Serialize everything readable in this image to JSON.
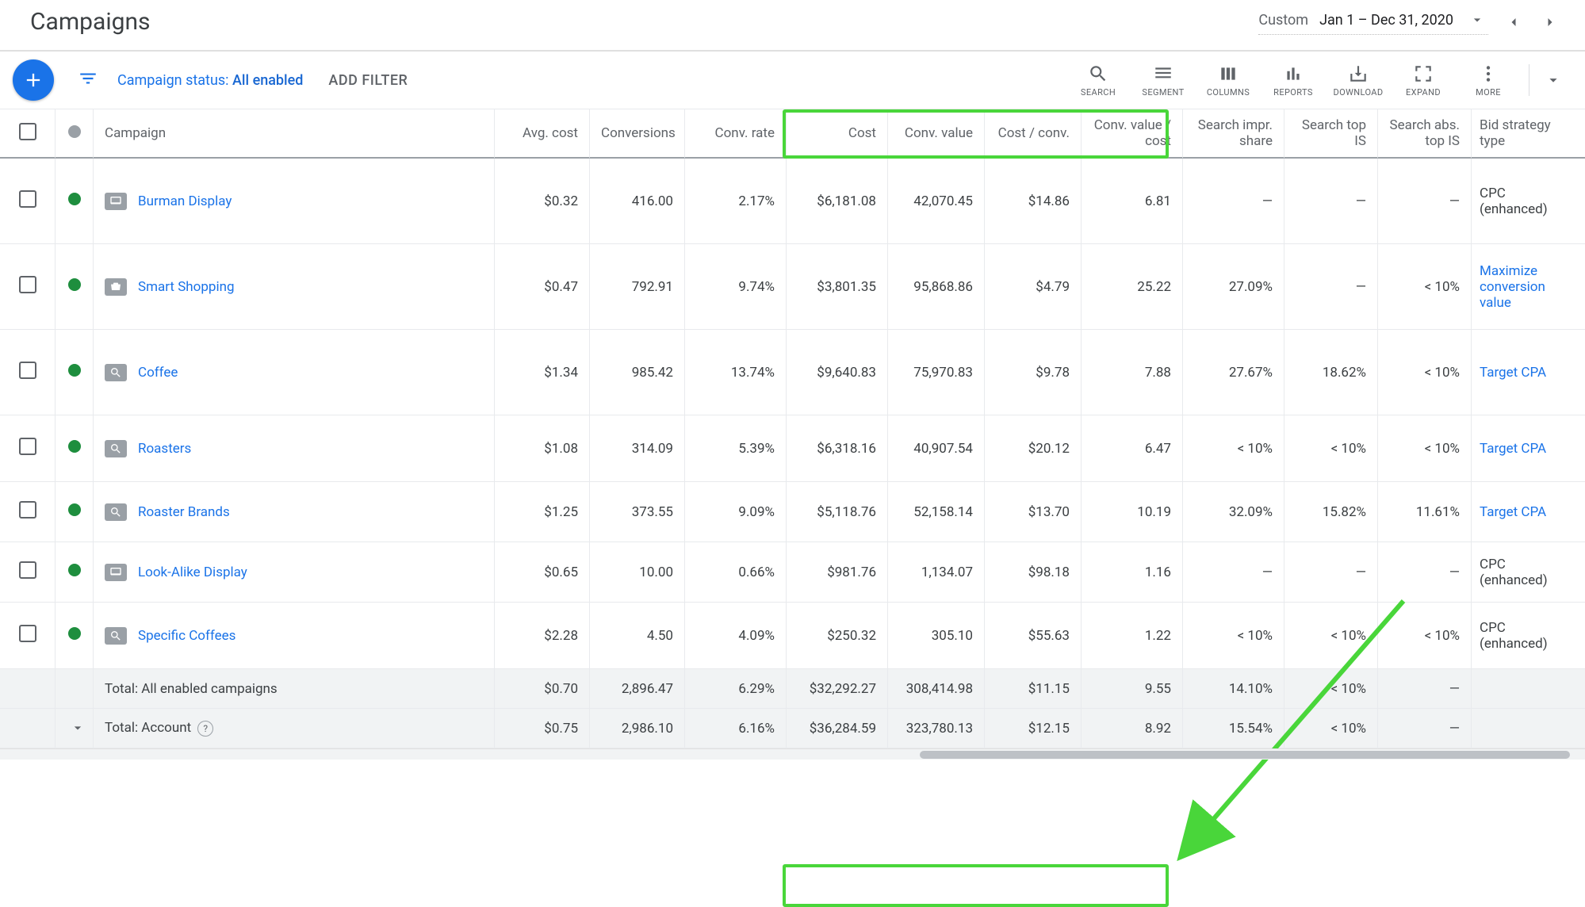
{
  "title": "Campaigns",
  "date": {
    "label": "Custom",
    "range": "Jan 1 – Dec 31, 2020"
  },
  "filter": {
    "status_prefix": "Campaign status: ",
    "status_value": "All enabled",
    "add_filter": "ADD FILTER"
  },
  "toolbar": [
    {
      "key": "search",
      "label": "SEARCH"
    },
    {
      "key": "segment",
      "label": "SEGMENT"
    },
    {
      "key": "columns",
      "label": "COLUMNS"
    },
    {
      "key": "reports",
      "label": "REPORTS"
    },
    {
      "key": "download",
      "label": "DOWNLOAD"
    },
    {
      "key": "expand",
      "label": "EXPAND"
    },
    {
      "key": "more",
      "label": "MORE"
    }
  ],
  "columns": {
    "campaign": "Campaign",
    "avg_cost": "Avg. cost",
    "conversions": "Conversions",
    "conv_rate": "Conv. rate",
    "cost": "Cost",
    "conv_value": "Conv. value",
    "cost_per_conv": "Cost / conv.",
    "conv_value_per_cost": "Conv. value / cost",
    "search_impr_share": "Search impr. share",
    "search_top_is": "Search top IS",
    "search_abs_top_is": "Search abs. top IS",
    "bid_strategy": "Bid strategy type"
  },
  "rows": [
    {
      "type": "display",
      "name": "Burman Display",
      "avg": "$0.32",
      "conv": "416.00",
      "rate": "2.17%",
      "cost": "$6,181.08",
      "cval": "42,070.45",
      "cpc": "$14.86",
      "cvpc": "6.81",
      "sis": "—",
      "stis": "—",
      "satis": "—",
      "bid": "CPC (enhanced)",
      "bid_link": false
    },
    {
      "type": "shopping",
      "name": "Smart Shopping",
      "avg": "$0.47",
      "conv": "792.91",
      "rate": "9.74%",
      "cost": "$3,801.35",
      "cval": "95,868.86",
      "cpc": "$4.79",
      "cvpc": "25.22",
      "sis": "27.09%",
      "stis": "—",
      "satis": "< 10%",
      "bid": "Maximize conversion value",
      "bid_link": true
    },
    {
      "type": "search",
      "name": "Coffee",
      "avg": "$1.34",
      "conv": "985.42",
      "rate": "13.74%",
      "cost": "$9,640.83",
      "cval": "75,970.83",
      "cpc": "$9.78",
      "cvpc": "7.88",
      "sis": "27.67%",
      "stis": "18.62%",
      "satis": "< 10%",
      "bid": "Target CPA",
      "bid_link": true
    },
    {
      "type": "search",
      "name": "Roasters",
      "avg": "$1.08",
      "conv": "314.09",
      "rate": "5.39%",
      "cost": "$6,318.16",
      "cval": "40,907.54",
      "cpc": "$20.12",
      "cvpc": "6.47",
      "sis": "< 10%",
      "stis": "< 10%",
      "satis": "< 10%",
      "bid": "Target CPA",
      "bid_link": true
    },
    {
      "type": "search",
      "name": "Roaster Brands",
      "avg": "$1.25",
      "conv": "373.55",
      "rate": "9.09%",
      "cost": "$5,118.76",
      "cval": "52,158.14",
      "cpc": "$13.70",
      "cvpc": "10.19",
      "sis": "32.09%",
      "stis": "15.82%",
      "satis": "11.61%",
      "bid": "Target CPA",
      "bid_link": true
    },
    {
      "type": "display",
      "name": "Look-Alike Display",
      "avg": "$0.65",
      "conv": "10.00",
      "rate": "0.66%",
      "cost": "$981.76",
      "cval": "1,134.07",
      "cpc": "$98.18",
      "cvpc": "1.16",
      "sis": "—",
      "stis": "—",
      "satis": "—",
      "bid": "CPC (enhanced)",
      "bid_link": false
    },
    {
      "type": "search",
      "name": "Specific Coffees",
      "avg": "$2.28",
      "conv": "4.50",
      "rate": "4.09%",
      "cost": "$250.32",
      "cval": "305.10",
      "cpc": "$55.63",
      "cvpc": "1.22",
      "sis": "< 10%",
      "stis": "< 10%",
      "satis": "< 10%",
      "bid": "CPC (enhanced)",
      "bid_link": false
    }
  ],
  "totals": {
    "enabled": {
      "label": "Total: All enabled campaigns",
      "avg": "$0.70",
      "conv": "2,896.47",
      "rate": "6.29%",
      "cost": "$32,292.27",
      "cval": "308,414.98",
      "cpc": "$11.15",
      "cvpc": "9.55",
      "sis": "14.10%",
      "stis": "< 10%",
      "satis": "—",
      "bid": ""
    },
    "account": {
      "label": "Total: Account",
      "avg": "$0.75",
      "conv": "2,986.10",
      "rate": "6.16%",
      "cost": "$36,284.59",
      "cval": "323,780.13",
      "cpc": "$12.15",
      "cvpc": "8.92",
      "sis": "15.54%",
      "stis": "< 10%",
      "satis": "—",
      "bid": ""
    }
  }
}
